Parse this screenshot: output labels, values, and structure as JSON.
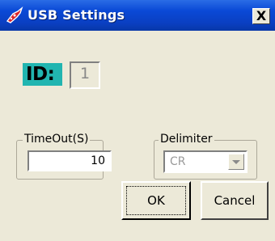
{
  "window": {
    "title": "USB Settings",
    "close_glyph": "X",
    "icon": "usb-app-icon"
  },
  "device": {
    "id_label": "ID:",
    "id_value": "1"
  },
  "timeout": {
    "legend": "TimeOut(S)",
    "value": "10"
  },
  "delimiter": {
    "legend": "Delimiter",
    "selected": "CR",
    "enabled": false
  },
  "buttons": {
    "ok": "OK",
    "cancel": "Cancel"
  },
  "colors": {
    "titlebar": "#0a49d6",
    "face": "#ece9d8",
    "id_badge": "#21b5b0"
  }
}
